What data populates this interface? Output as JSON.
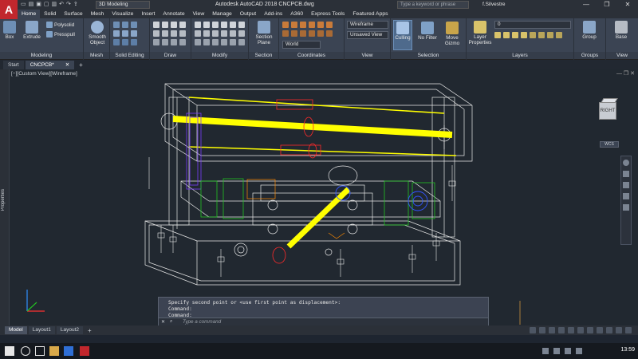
{
  "app": {
    "logo_letter": "A",
    "workspace": "3D Modeling",
    "window_title": "Autodesk AutoCAD 2018    CNCPCB.dwg",
    "search_placeholder": "Type a keyword or phrase",
    "user": "f.Silvestre",
    "minimize": "—",
    "maximize": "❐",
    "close": "✕"
  },
  "ribbon_tabs": [
    "Home",
    "Solid",
    "Surface",
    "Mesh",
    "Visualize",
    "Insert",
    "Annotate",
    "View",
    "Manage",
    "Output",
    "Add-ins",
    "A360",
    "Express Tools",
    "Featured Apps"
  ],
  "panels": {
    "modeling": "Modeling",
    "mesh": "Mesh",
    "solid_editing": "Solid Editing",
    "draw": "Draw",
    "modify": "Modify",
    "section": "Section",
    "coordinates": "Coordinates",
    "view": "View",
    "selection": "Selection",
    "layers": "Layers",
    "groups": "Groups",
    "view2": "View"
  },
  "tools": {
    "box": "Box",
    "extrude": "Extrude",
    "polysolid": "Polysolid",
    "presspull": "Presspull",
    "smooth_object": "Smooth Object",
    "section_plane": "Section Plane",
    "culling": "Culling",
    "no_filter": "No Filter",
    "move_gizmo": "Move Gizmo",
    "layer_properties": "Layer Properties",
    "group": "Group",
    "base": "Base"
  },
  "combos": {
    "visual_style": "Wireframe",
    "view": "Unsaved View",
    "ucs": "World",
    "layer": "0"
  },
  "doc_tabs": [
    {
      "label": "Start"
    },
    {
      "label": "CNCPCB*"
    }
  ],
  "add_tab": "+",
  "viewport": {
    "label": "[−][Custom View][Wireframe]",
    "controls": "—  ❐  ✕",
    "palette_label": "Properties",
    "viewcube_face": "RIGHT",
    "wcs": "WCS"
  },
  "command": {
    "lines": [
      "Specify second point or <use first point as displacement>:",
      "Command:",
      "Command:"
    ],
    "placeholder": "Type a command"
  },
  "layout_tabs": [
    "Model",
    "Layout1",
    "Layout2"
  ],
  "layout_add": "+",
  "clock": "13:59",
  "colors": {
    "accent_red": "#c1272d",
    "yellow": "#ffff00",
    "wire": "#e8e8e8",
    "green": "#22c322",
    "blue": "#3355ff",
    "purple": "#7a3cff",
    "orange": "#ff8a00"
  }
}
